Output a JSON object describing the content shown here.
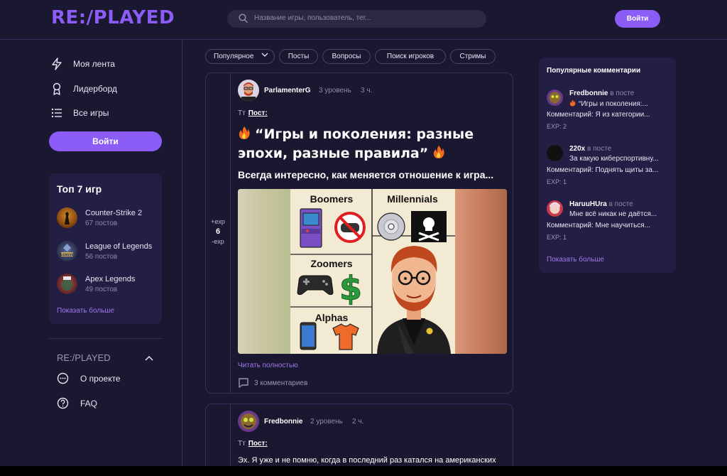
{
  "header": {
    "logo": "RE:/PLAYED",
    "search_placeholder": "Название игры, пользователь, тег...",
    "login": "Войти"
  },
  "sidebar": {
    "nav": [
      {
        "label": "Моя лента",
        "icon": "lightning-icon"
      },
      {
        "label": "Лидерборд",
        "icon": "award-icon"
      },
      {
        "label": "Все игры",
        "icon": "list-icon"
      }
    ],
    "login": "Войти",
    "top_games": {
      "title": "Топ 7 игр",
      "items": [
        {
          "name": "Counter-Strike 2",
          "count": "67 постов"
        },
        {
          "name": "League of Legends",
          "count": "56 постов"
        },
        {
          "name": "Apex Legends",
          "count": "49 постов"
        }
      ],
      "show_more": "Показать больше"
    },
    "brand": "RE:/PLAYED",
    "links": [
      {
        "label": "О проекте",
        "icon": "dots-circle-icon"
      },
      {
        "label": "FAQ",
        "icon": "question-circle-icon"
      }
    ]
  },
  "filters": [
    "Популярное",
    "Посты",
    "Вопросы",
    "Поиск игроков",
    "Стримы"
  ],
  "posts": [
    {
      "author": "ParlamenterG",
      "level": "3 уровень",
      "time": "3 ч.",
      "type": "Пост:",
      "title": "“Игры и поколения: разные эпохи, разные правила”",
      "subtitle": "Всегда интересно, как меняется отношение к игра...",
      "image_labels": [
        "Boomers",
        "Millennials",
        "Zoomers",
        "Alphas"
      ],
      "vote_plus": "+exp",
      "vote_count": "6",
      "vote_minus": "-exp",
      "read_more": "Читать полностью",
      "comments": "3 комментариев"
    },
    {
      "author": "Fredbonnie",
      "level": "2 уровень",
      "time": "2 ч.",
      "type": "Пост:",
      "text": "Эх. Я уже и не помню, когда в последний раз катался на американских"
    }
  ],
  "popular_comments": {
    "title": "Популярные комментарии",
    "items": [
      {
        "user": "Fredbonnie",
        "in_post": "в посте",
        "post": "“Игры и поколения:...",
        "comment": "Комментарий: Я из категории...",
        "exp": "EXP: 2"
      },
      {
        "user": "220x",
        "in_post": "в посте",
        "post": "За какую киберспортивну...",
        "comment": "Комментарий: Поднять щиты за...",
        "exp": "EXP: 1"
      },
      {
        "user": "HaruuHUra",
        "in_post": "в посте",
        "post": "Мне всё никак не даётся...",
        "comment": "Комментарий: Мне научиться...",
        "exp": "EXP: 1"
      }
    ],
    "show_more": "Показать больше"
  }
}
